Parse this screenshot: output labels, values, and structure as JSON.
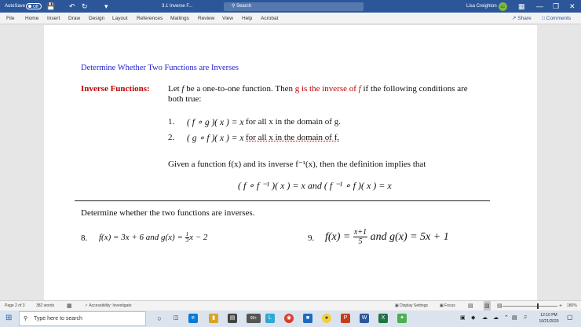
{
  "titlebar": {
    "autosave_label": "AutoSave",
    "autosave_state": "Off",
    "doc_title": "3.1 Inverse F...",
    "search_placeholder": "Search",
    "user_name": "Lisa Creighton",
    "user_initials": "LC",
    "minimize": "—",
    "restore": "❐",
    "close": "✕"
  },
  "menu": {
    "items": [
      "File",
      "Home",
      "Insert",
      "Draw",
      "Design",
      "Layout",
      "References",
      "Mailings",
      "Review",
      "View",
      "Help",
      "Acrobat"
    ],
    "share_label": "Share",
    "comments_label": "Comments"
  },
  "doc": {
    "heading": "Determine Whether Two Functions are Inverses",
    "inv_label": "Inverse Functions:",
    "def_p1": "Let ",
    "def_p2": " be a one-to-one function.  Then ",
    "def_red": "g is the inverse of",
    "def_p3": " if the following conditions are",
    "def_line2": "both true:",
    "cond1_num": "1.",
    "cond1_expr": "( f ∘ g )( x ) = x",
    "cond1_text": "for all x in the domain of g.",
    "cond2_num": "2.",
    "cond2_expr": "( g ∘ f )( x ) = x",
    "cond2_text": "for all x in the domain of f.",
    "given_text": "Given a function f(x)  and its inverse f⁻¹(x), then the definition implies that",
    "identity": "( f ∘ f ⁻¹ )( x ) = x and ( f ⁻¹ ∘ f )( x ) = x",
    "task": "Determine whether the two functions are inverses.",
    "prob8_num": "8.",
    "prob8_pre": "f(x) = 3x + 6 and g(x) = ",
    "prob8_frac_num": "1",
    "prob8_frac_den": "3",
    "prob8_post": "x − 2",
    "prob9_num": "9.",
    "prob9_pre": "f(x) =",
    "prob9_frac_num": "x+1",
    "prob9_frac_den": "5",
    "prob9_post": "and   g(x) = 5x + 1"
  },
  "status": {
    "page": "Page 2 of 3",
    "words": "382 words",
    "accessibility": "Accessibility: Investigate",
    "display_settings": "Display Settings",
    "focus": "Focus",
    "zoom": "180%"
  },
  "taskbar": {
    "search_placeholder": "Type here to search",
    "badge": "99+",
    "time": "12:10 PM",
    "date": "10/21/2020"
  }
}
